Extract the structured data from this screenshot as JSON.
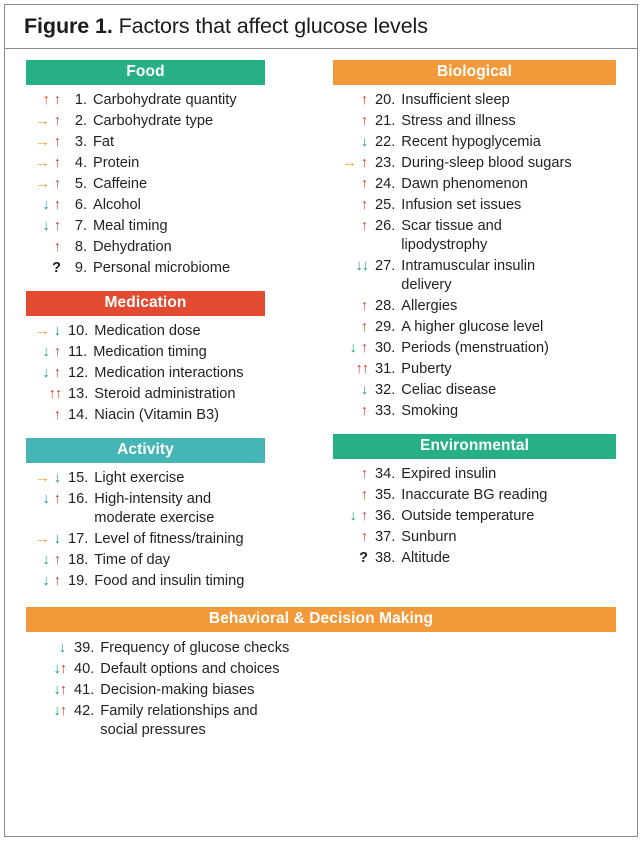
{
  "figure": {
    "label": "Figure 1.",
    "title": "Factors that affect glucose levels"
  },
  "colors": {
    "food_header": "#27b085",
    "medication_header": "#e24b31",
    "activity_header": "#45b5b5",
    "biological_header": "#f29a3a",
    "environmental_header": "#27b085",
    "behavioral_header": "#f29a3a",
    "arrow_up": "#d4442c",
    "arrow_down": "#1a9e8f",
    "arrow_right": "#f0952e",
    "text": "#231f20",
    "border": "#8a8a8a"
  },
  "icon_legend": {
    "up": "arrow-up-icon",
    "down": "arrow-down-icon",
    "right": "arrow-right-icon",
    "unknown": "question-mark-icon"
  },
  "sections": {
    "food": {
      "header": "Food",
      "items": [
        {
          "num": "1.",
          "label": "Carbohydrate quantity",
          "arrows": [
            "up",
            "up"
          ]
        },
        {
          "num": "2.",
          "label": "Carbohydrate type",
          "arrows": [
            "right",
            "up"
          ]
        },
        {
          "num": "3.",
          "label": "Fat",
          "arrows": [
            "right",
            "up"
          ]
        },
        {
          "num": "4.",
          "label": "Protein",
          "arrows": [
            "right",
            "up"
          ]
        },
        {
          "num": "5.",
          "label": "Caffeine",
          "arrows": [
            "right",
            "up"
          ]
        },
        {
          "num": "6.",
          "label": "Alcohol",
          "arrows": [
            "down",
            "up"
          ]
        },
        {
          "num": "7.",
          "label": "Meal timing",
          "arrows": [
            "down",
            "up"
          ]
        },
        {
          "num": "8.",
          "label": "Dehydration",
          "arrows": [
            "up"
          ]
        },
        {
          "num": "9.",
          "label": "Personal microbiome",
          "arrows": [
            "unknown"
          ]
        }
      ]
    },
    "medication": {
      "header": "Medication",
      "items": [
        {
          "num": "10.",
          "label": "Medication dose",
          "arrows": [
            "right",
            "down"
          ]
        },
        {
          "num": "11.",
          "label": "Medication timing",
          "arrows": [
            "down",
            "up"
          ]
        },
        {
          "num": "12.",
          "label": "Medication interactions",
          "arrows": [
            "down",
            "up"
          ]
        },
        {
          "num": "13.",
          "label": "Steroid administration",
          "arrows": [
            "up",
            "up"
          ],
          "tight": true
        },
        {
          "num": "14.",
          "label": "Niacin (Vitamin B3)",
          "arrows": [
            "up"
          ]
        }
      ]
    },
    "activity": {
      "header": "Activity",
      "items": [
        {
          "num": "15.",
          "label": "Light exercise",
          "arrows": [
            "right",
            "down"
          ]
        },
        {
          "num": "16.",
          "label": "High-intensity and",
          "label2": "moderate exercise",
          "arrows": [
            "down",
            "up"
          ]
        },
        {
          "num": "17.",
          "label": "Level of fitness/training",
          "arrows": [
            "right",
            "down"
          ]
        },
        {
          "num": "18.",
          "label": "Time of day",
          "arrows": [
            "down",
            "up"
          ]
        },
        {
          "num": "19.",
          "label": "Food and insulin timing",
          "arrows": [
            "down",
            "up"
          ]
        }
      ]
    },
    "biological": {
      "header": "Biological",
      "items": [
        {
          "num": "20.",
          "label": "Insufficient sleep",
          "arrows": [
            "up"
          ]
        },
        {
          "num": "21.",
          "label": "Stress and illness",
          "arrows": [
            "up"
          ]
        },
        {
          "num": "22.",
          "label": "Recent hypoglycemia",
          "arrows": [
            "down"
          ]
        },
        {
          "num": "23.",
          "label": "During-sleep blood sugars",
          "arrows": [
            "right",
            "up"
          ]
        },
        {
          "num": "24.",
          "label": "Dawn phenomenon",
          "arrows": [
            "up"
          ]
        },
        {
          "num": "25.",
          "label": "Infusion set issues",
          "arrows": [
            "up"
          ]
        },
        {
          "num": "26.",
          "label": "Scar tissue and",
          "label2": "lipodystrophy",
          "arrows": [
            "up"
          ]
        },
        {
          "num": "27.",
          "label": "Intramuscular insulin",
          "label2": "delivery",
          "arrows": [
            "down",
            "down"
          ],
          "tight": true
        },
        {
          "num": "28.",
          "label": "Allergies",
          "arrows": [
            "up"
          ]
        },
        {
          "num": "29.",
          "label": "A higher glucose level",
          "arrows": [
            "up"
          ]
        },
        {
          "num": "30.",
          "label": "Periods (menstruation)",
          "arrows": [
            "down",
            "up"
          ]
        },
        {
          "num": "31.",
          "label": "Puberty",
          "arrows": [
            "up",
            "up"
          ],
          "tight": true
        },
        {
          "num": "32.",
          "label": "Celiac disease",
          "arrows": [
            "down"
          ]
        },
        {
          "num": "33.",
          "label": "Smoking",
          "arrows": [
            "up"
          ]
        }
      ]
    },
    "environmental": {
      "header": "Environmental",
      "items": [
        {
          "num": "34.",
          "label": "Expired insulin",
          "arrows": [
            "up"
          ]
        },
        {
          "num": "35.",
          "label": "Inaccurate BG reading",
          "arrows": [
            "up"
          ]
        },
        {
          "num": "36.",
          "label": "Outside temperature",
          "arrows": [
            "down",
            "up"
          ]
        },
        {
          "num": "37.",
          "label": "Sunburn",
          "arrows": [
            "up"
          ]
        },
        {
          "num": "38.",
          "label": "Altitude",
          "arrows": [
            "unknown"
          ]
        }
      ]
    },
    "behavioral": {
      "header": "Behavioral & Decision Making",
      "items": [
        {
          "num": "39.",
          "label": "Frequency of glucose checks",
          "arrows": [
            "down"
          ]
        },
        {
          "num": "40.",
          "label": "Default options and choices",
          "arrows": [
            "down",
            "up"
          ],
          "tight": true
        },
        {
          "num": "41.",
          "label": "Decision-making biases",
          "arrows": [
            "down",
            "up"
          ],
          "tight": true
        },
        {
          "num": "42.",
          "label": "Family relationships and",
          "label2": "social pressures",
          "arrows": [
            "down",
            "up"
          ],
          "tight": true
        }
      ]
    }
  }
}
